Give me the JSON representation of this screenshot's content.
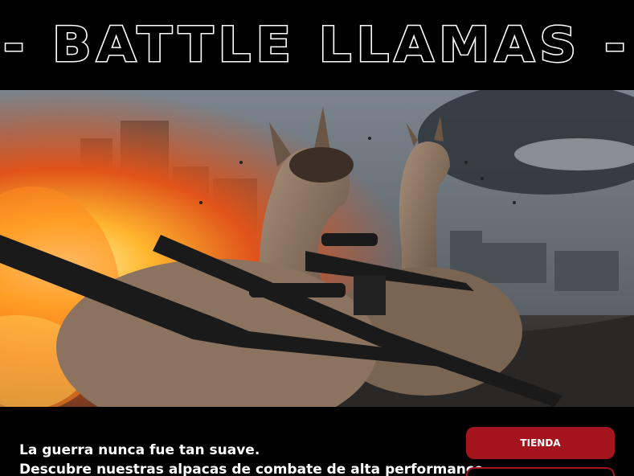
{
  "header": {
    "title": "- BATTLE LLAMAS -"
  },
  "hero": {
    "image_alt": "llamas-with-rifles-battlefield-image"
  },
  "tagline": {
    "line1": "La guerra nunca fue tan suave.",
    "line2": "Descubre nuestras alpacas de combate de alta performance"
  },
  "buttons": {
    "primary_label": "TIENDA",
    "secondary_label": ""
  },
  "colors": {
    "background": "#000000",
    "accent": "#a3141c",
    "text": "#ffffff"
  }
}
